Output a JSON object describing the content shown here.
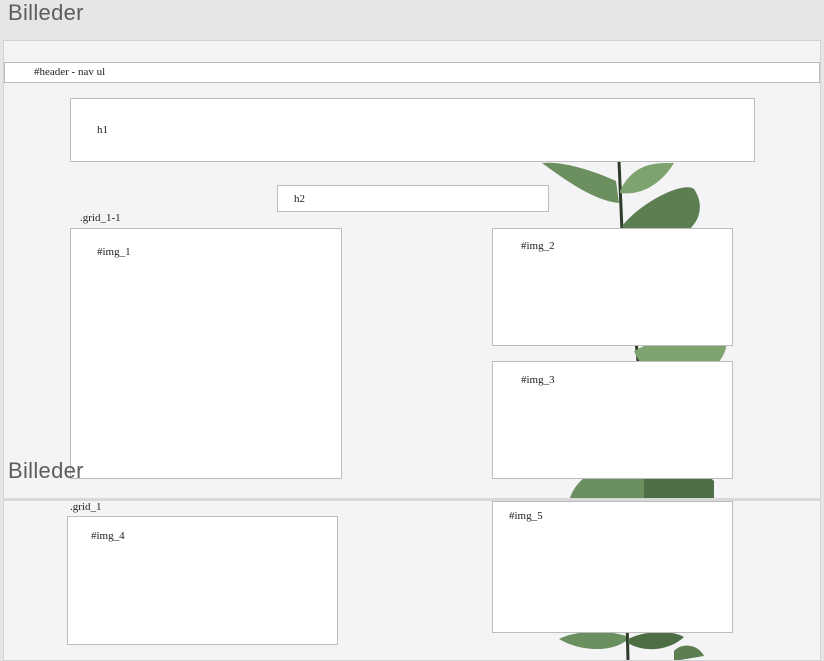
{
  "artboards": [
    {
      "title": "Billeder",
      "header_nav": {
        "label": "#header - nav ul"
      },
      "h1": {
        "label": "h1"
      },
      "h2": {
        "label": "h2"
      },
      "grid": {
        "label": ".grid_1-1",
        "items": [
          {
            "label": "#img_1"
          },
          {
            "label": "#img_2"
          },
          {
            "label": "#img_3"
          }
        ]
      }
    },
    {
      "title": "Billeder",
      "grid": {
        "label": ".grid_1",
        "items": [
          {
            "label": "#img_4"
          },
          {
            "label": "#img_5"
          }
        ]
      }
    }
  ],
  "colors": {
    "canvas": "#e6e6e6",
    "artboard": "#f4f4f6",
    "box": "#ffffff",
    "box_border": "#bdbdbd",
    "leaf_dark": "#4e6f45",
    "leaf_light": "#8fb57f"
  }
}
